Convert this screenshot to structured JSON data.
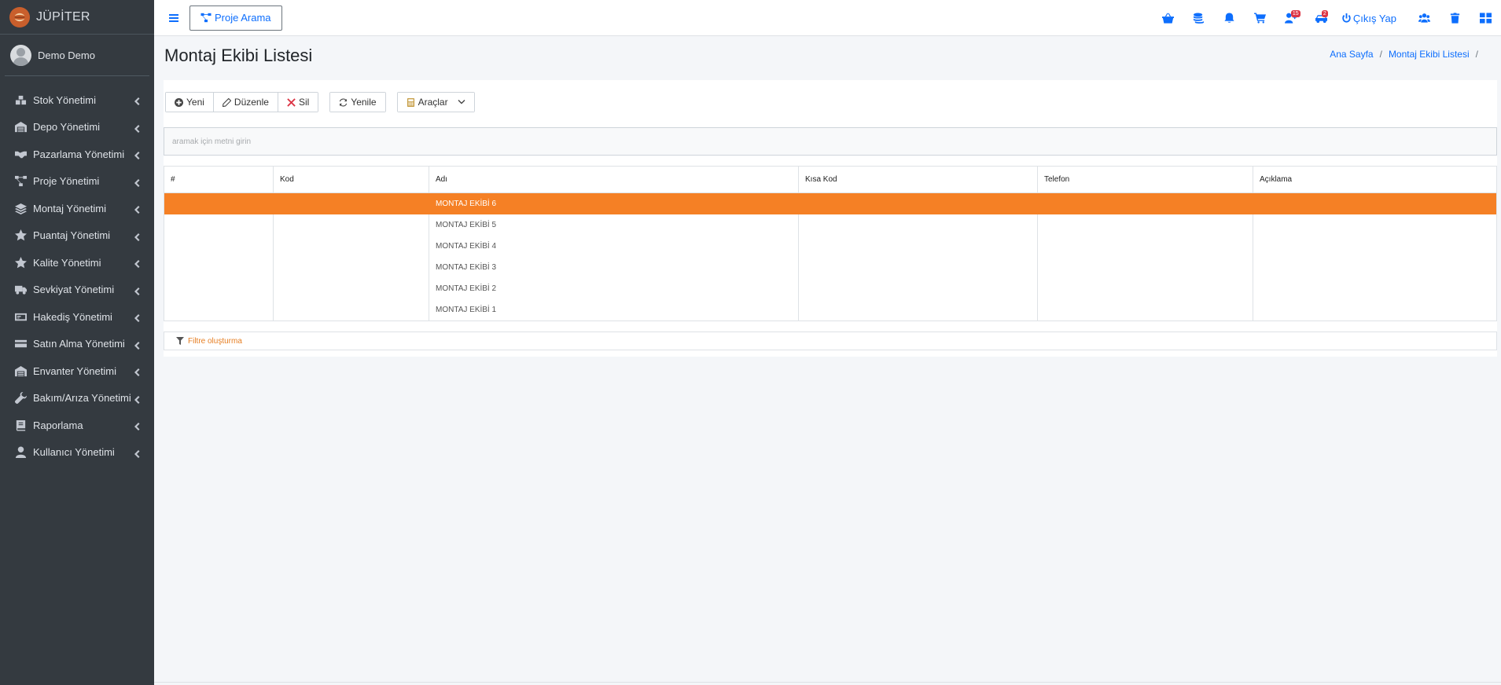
{
  "brand": {
    "name": "JÜPİTER"
  },
  "user": {
    "name": "Demo Demo"
  },
  "sidebar": {
    "items": [
      {
        "label": "Stok Yönetimi",
        "icon": "boxes-icon"
      },
      {
        "label": "Depo Yönetimi",
        "icon": "warehouse-icon"
      },
      {
        "label": "Pazarlama Yönetimi",
        "icon": "handshake-icon"
      },
      {
        "label": "Proje Yönetimi",
        "icon": "project-diagram-icon"
      },
      {
        "label": "Montaj Yönetimi",
        "icon": "layers-icon"
      },
      {
        "label": "Puantaj Yönetimi",
        "icon": "star-icon"
      },
      {
        "label": "Kalite Yönetimi",
        "icon": "star-icon"
      },
      {
        "label": "Sevkiyat Yönetimi",
        "icon": "truck-icon"
      },
      {
        "label": "Hakediş Yönetimi",
        "icon": "money-bill-icon"
      },
      {
        "label": "Satın Alma Yönetimi",
        "icon": "credit-card-icon"
      },
      {
        "label": "Envanter Yönetimi",
        "icon": "warehouse-icon"
      },
      {
        "label": "Bakım/Arıza Yönetimi",
        "icon": "wrench-icon"
      },
      {
        "label": "Raporlama",
        "icon": "book-icon"
      },
      {
        "label": "Kullanıcı Yönetimi",
        "icon": "user-icon"
      }
    ]
  },
  "header": {
    "project_search_label": "Proje Arama",
    "badges": {
      "users": "15",
      "cars": "2"
    },
    "logout_label": "Çıkış Yap"
  },
  "page": {
    "title": "Montaj Ekibi Listesi",
    "breadcrumb": [
      "Ana Sayfa",
      "Montaj Ekibi Listesi"
    ]
  },
  "toolbar": {
    "new_label": "Yeni",
    "edit_label": "Düzenle",
    "delete_label": "Sil",
    "refresh_label": "Yenile",
    "tools_label": "Araçlar"
  },
  "search": {
    "placeholder": "aramak için metni girin"
  },
  "table": {
    "columns": [
      "#",
      "Kod",
      "Adı",
      "Kısa Kod",
      "Telefon",
      "Açıklama"
    ],
    "rows": [
      {
        "no": "",
        "kod": "",
        "adi": "MONTAJ EKİBİ 6",
        "kisa_kod": "",
        "telefon": "",
        "aciklama": ""
      },
      {
        "no": "",
        "kod": "",
        "adi": "MONTAJ EKİBİ 5",
        "kisa_kod": "",
        "telefon": "",
        "aciklama": ""
      },
      {
        "no": "",
        "kod": "",
        "adi": "MONTAJ EKİBİ 4",
        "kisa_kod": "",
        "telefon": "",
        "aciklama": ""
      },
      {
        "no": "",
        "kod": "",
        "adi": "MONTAJ EKİBİ 3",
        "kisa_kod": "",
        "telefon": "",
        "aciklama": ""
      },
      {
        "no": "",
        "kod": "",
        "adi": "MONTAJ EKİBİ 2",
        "kisa_kod": "",
        "telefon": "",
        "aciklama": ""
      },
      {
        "no": "",
        "kod": "",
        "adi": "MONTAJ EKİBİ 1",
        "kisa_kod": "",
        "telefon": "",
        "aciklama": ""
      }
    ],
    "selected_row": 0
  },
  "filter": {
    "label": "Filtre oluşturma"
  },
  "colors": {
    "sidebar_bg": "#343a40",
    "accent_blue": "#0d6efd",
    "selected_row": "#f58025",
    "badge_red": "#dc3545"
  }
}
